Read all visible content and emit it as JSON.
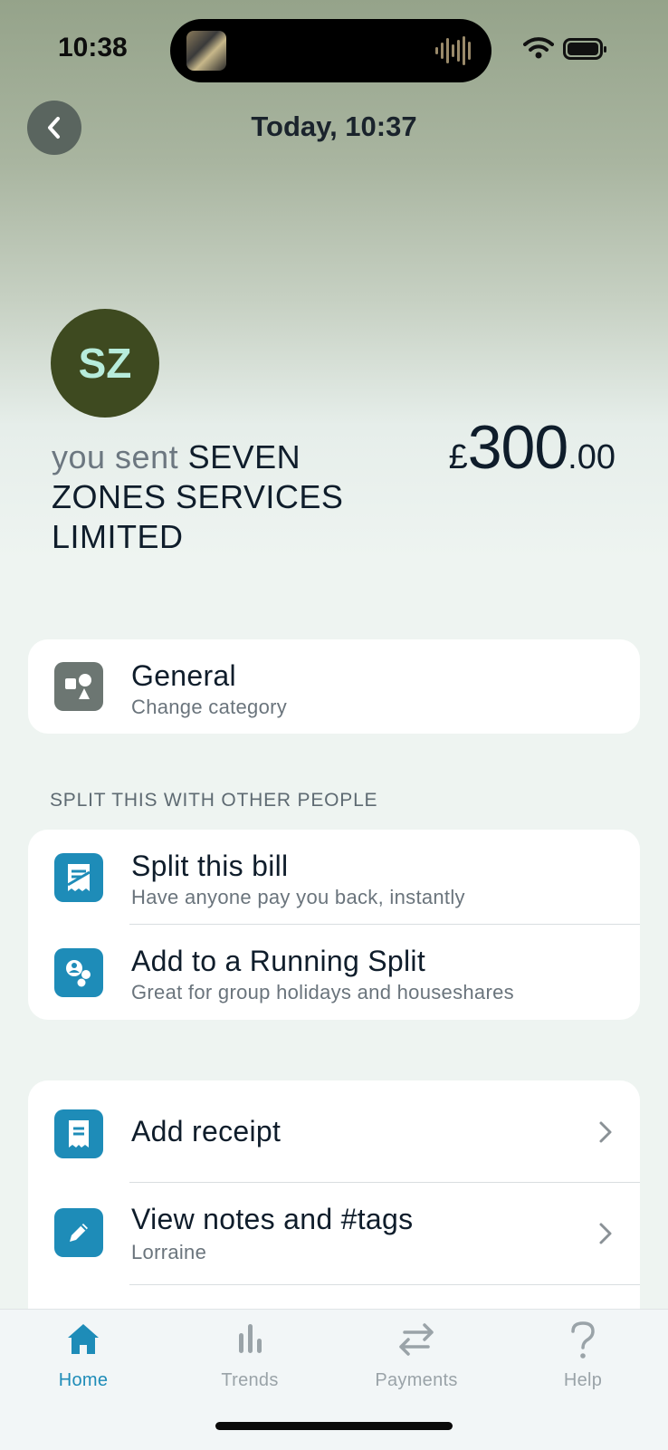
{
  "status_bar": {
    "time": "10:38"
  },
  "header": {
    "title": "Today, 10:37"
  },
  "transaction": {
    "avatar_initials": "SZ",
    "sent_prefix": "you sent",
    "recipient": "SEVEN ZONES SERVICES LIMITED",
    "currency": "£",
    "amount_whole": "300",
    "amount_decimal": ".00"
  },
  "category": {
    "title": "General",
    "subtitle": "Change category"
  },
  "split_section": {
    "label": "SPLIT THIS WITH OTHER PEOPLE",
    "items": [
      {
        "title": "Split this bill",
        "subtitle": "Have anyone pay you back, instantly"
      },
      {
        "title": "Add to a Running Split",
        "subtitle": "Great for group holidays and houseshares"
      }
    ]
  },
  "actions": {
    "items": [
      {
        "title": "Add receipt"
      },
      {
        "title": "View notes and #tags",
        "subtitle": "Lorraine"
      }
    ]
  },
  "tabbar": {
    "tabs": [
      {
        "label": "Home"
      },
      {
        "label": "Trends"
      },
      {
        "label": "Payments"
      },
      {
        "label": "Help"
      }
    ]
  },
  "colors": {
    "accent": "#1e8cb8",
    "avatar_bg": "#3e4a20",
    "avatar_text": "#b7ecdb"
  }
}
